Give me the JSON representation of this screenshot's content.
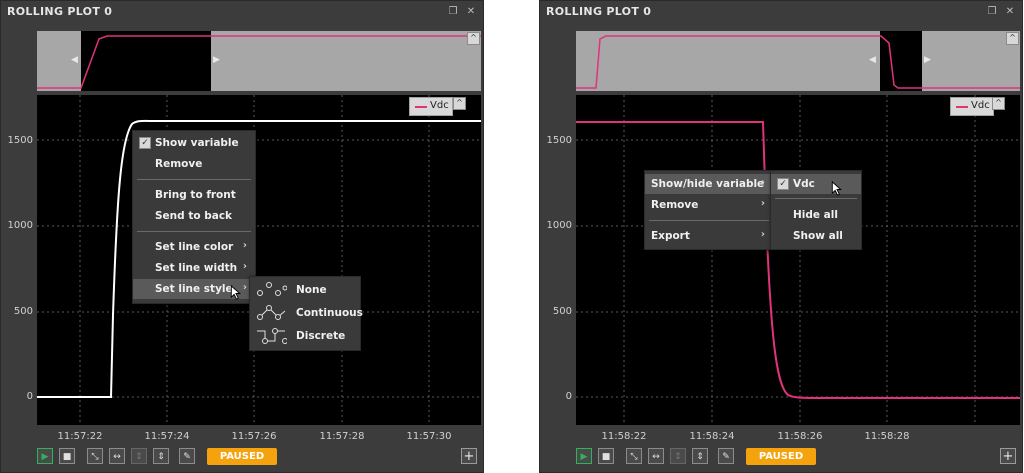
{
  "colors": {
    "trace_pink": "#e0337a",
    "trace_white": "#ffffff",
    "paused_orange": "#f5a20f",
    "play_green": "#2fb35d"
  },
  "panel_left": {
    "title": "ROLLING PLOT 0",
    "legend": "Vdc",
    "y_ticks": [
      "1500",
      "1000",
      "500",
      "0"
    ],
    "x_ticks": [
      "11:57:22",
      "11:57:24",
      "11:57:26",
      "11:57:28",
      "11:57:30"
    ],
    "status": "PAUSED",
    "context_menu": {
      "show_variable": "Show variable",
      "remove": "Remove",
      "bring_to_front": "Bring to front",
      "send_to_back": "Send to back",
      "set_line_color": "Set line color",
      "set_line_width": "Set line width",
      "set_line_style": "Set line style"
    },
    "line_style_menu": {
      "none": "None",
      "continuous": "Continuous",
      "discrete": "Discrete"
    }
  },
  "panel_right": {
    "title": "ROLLING PLOT 0",
    "legend": "Vdc",
    "y_ticks": [
      "1500",
      "1000",
      "500",
      "0"
    ],
    "x_ticks": [
      "11:58:22",
      "11:58:24",
      "11:58:26",
      "11:58:28"
    ],
    "status": "PAUSED",
    "context_menu": {
      "show_hide_variable": "Show/hide variable",
      "remove": "Remove",
      "export": "Export"
    },
    "variable_menu": {
      "vdc": "Vdc",
      "hide_all": "Hide all",
      "show_all": "Show all"
    }
  }
}
